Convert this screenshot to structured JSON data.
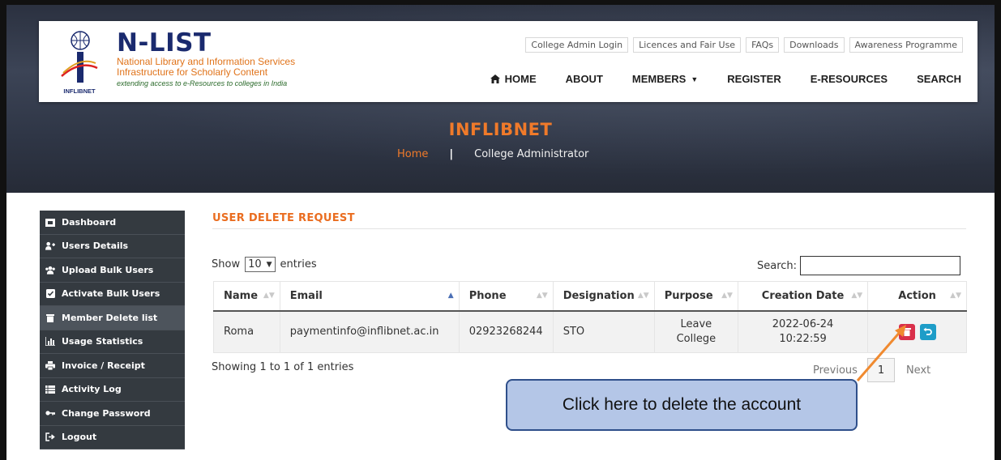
{
  "header": {
    "brand_name": "N-LIST",
    "brand_line1": "National Library and Information Services",
    "brand_line2": "Infrastructure for Scholarly Content",
    "brand_tagline": "extending access to e-Resources to colleges in India",
    "logo_text": "INFLIBNET",
    "top_links": [
      "College Admin Login",
      "Licences and Fair Use",
      "FAQs",
      "Downloads",
      "Awareness Programme"
    ],
    "nav": [
      "HOME",
      "ABOUT",
      "MEMBERS",
      "REGISTER",
      "E-RESOURCES",
      "SEARCH"
    ]
  },
  "hero": {
    "title": "INFLIBNET",
    "breadcrumb_home": "Home",
    "breadcrumb_sep": "|",
    "breadcrumb_current": "College Administrator"
  },
  "sidebar": {
    "items": [
      {
        "label": "Dashboard",
        "icon": "dashboard-icon"
      },
      {
        "label": "Users Details",
        "icon": "users-icon"
      },
      {
        "label": "Upload Bulk Users",
        "icon": "users-group-icon"
      },
      {
        "label": "Activate Bulk Users",
        "icon": "check-square-icon"
      },
      {
        "label": "Member Delete list",
        "icon": "trash-icon"
      },
      {
        "label": "Usage Statistics",
        "icon": "bar-chart-icon"
      },
      {
        "label": "Invoice / Receipt",
        "icon": "print-icon"
      },
      {
        "label": "Activity Log",
        "icon": "list-icon"
      },
      {
        "label": "Change Password",
        "icon": "key-icon"
      },
      {
        "label": "Logout",
        "icon": "sign-out-icon"
      }
    ],
    "active_index": 4
  },
  "main": {
    "section_title": "USER DELETE REQUEST",
    "show_label": "Show",
    "entries_value": "10",
    "entries_label": "entries",
    "search_label": "Search:",
    "search_value": "",
    "columns": [
      "Name",
      "Email",
      "Phone",
      "Designation",
      "Purpose",
      "Creation Date",
      "Action"
    ],
    "rows": [
      {
        "name": "Roma",
        "email": "paymentinfo@inflibnet.ac.in",
        "phone": "02923268244",
        "designation": "STO",
        "purpose": "Leave College",
        "creation_date": "2022-06-24 10:22:59"
      }
    ],
    "info": "Showing 1 to 1 of 1 entries",
    "pagination": {
      "previous": "Previous",
      "page": "1",
      "next": "Next"
    }
  },
  "callout": {
    "text": "Click here to delete the account"
  },
  "colors": {
    "accent_orange": "#f07a2a",
    "brand_blue": "#1a2a6e",
    "sidebar_bg": "#343a40",
    "delete_red": "#d9304a",
    "restore_blue": "#1e9dc8",
    "callout_bg": "#b4c6e7"
  }
}
